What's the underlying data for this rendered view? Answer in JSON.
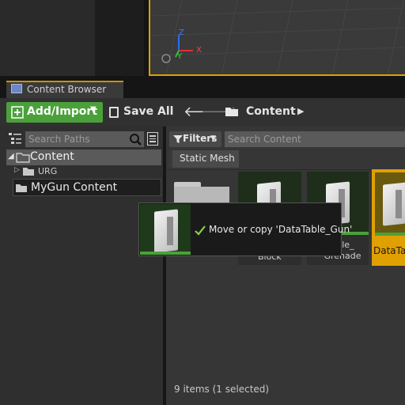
{
  "viewport": {
    "axis_z": "Z",
    "axis_x": "X",
    "axis_y": "Y"
  },
  "tab": {
    "title": "Content Browser"
  },
  "toolbar": {
    "add_import": "Add/Import",
    "save_all": "Save All",
    "breadcrumb": "Content"
  },
  "paths": {
    "search_placeholder": "Search Paths",
    "tree": [
      {
        "label": "Content",
        "level": 0,
        "expanded": true
      },
      {
        "label": "URG",
        "level": 1,
        "expanded": false
      },
      {
        "label": "MyGun Content",
        "level": 0,
        "expanded": false
      }
    ]
  },
  "content": {
    "filters_label": "Filters",
    "search_placeholder": "Search Content",
    "filter_chip": "Static Mesh",
    "tiles": [
      {
        "label": "Block"
      },
      {
        "label": "able_ Grenade"
      },
      {
        "label": "DataTa"
      }
    ],
    "status": "9 items (1 selected)"
  },
  "drag_tooltip": {
    "text": "Move or copy 'DataTable_Gun'"
  },
  "colors": {
    "accent": "#d9a300",
    "add_button": "#4aa13a",
    "selected_tile": "#e0a000"
  }
}
